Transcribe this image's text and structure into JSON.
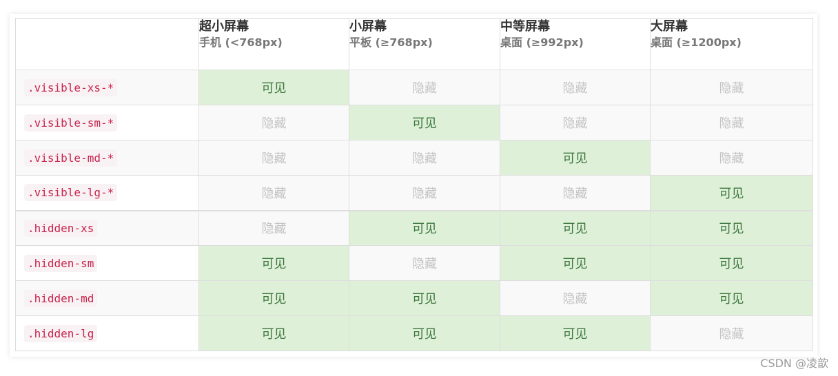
{
  "headers": [
    {
      "title": "",
      "subtitle": ""
    },
    {
      "title": "超小屏幕",
      "subtitle": "手机 (<768px)"
    },
    {
      "title": "小屏幕",
      "subtitle": "平板 (≥768px)"
    },
    {
      "title": "中等屏幕",
      "subtitle": "桌面 (≥992px)"
    },
    {
      "title": "大屏幕",
      "subtitle": "桌面 (≥1200px)"
    }
  ],
  "rows": [
    {
      "class_name": ".visible-xs-*",
      "cells": [
        "可见",
        "隐藏",
        "隐藏",
        "隐藏"
      ]
    },
    {
      "class_name": ".visible-sm-*",
      "cells": [
        "隐藏",
        "可见",
        "隐藏",
        "隐藏"
      ]
    },
    {
      "class_name": ".visible-md-*",
      "cells": [
        "隐藏",
        "隐藏",
        "可见",
        "隐藏"
      ]
    },
    {
      "class_name": ".visible-lg-*",
      "cells": [
        "隐藏",
        "隐藏",
        "隐藏",
        "可见"
      ]
    },
    {
      "class_name": ".hidden-xs",
      "cells": [
        "隐藏",
        "可见",
        "可见",
        "可见"
      ]
    },
    {
      "class_name": ".hidden-sm",
      "cells": [
        "可见",
        "隐藏",
        "可见",
        "可见"
      ]
    },
    {
      "class_name": ".hidden-md",
      "cells": [
        "可见",
        "可见",
        "隐藏",
        "可见"
      ]
    },
    {
      "class_name": ".hidden-lg",
      "cells": [
        "可见",
        "可见",
        "可见",
        "隐藏"
      ]
    }
  ],
  "values": {
    "visible": "可见",
    "hidden": "隐藏"
  },
  "colors": {
    "visible_bg": "#dff0d8",
    "visible_text": "#3c763d",
    "hidden_text": "#c4c4c4",
    "code_text": "#c7254e",
    "code_bg": "#f9f2f4"
  },
  "watermark": "CSDN @凌歆"
}
